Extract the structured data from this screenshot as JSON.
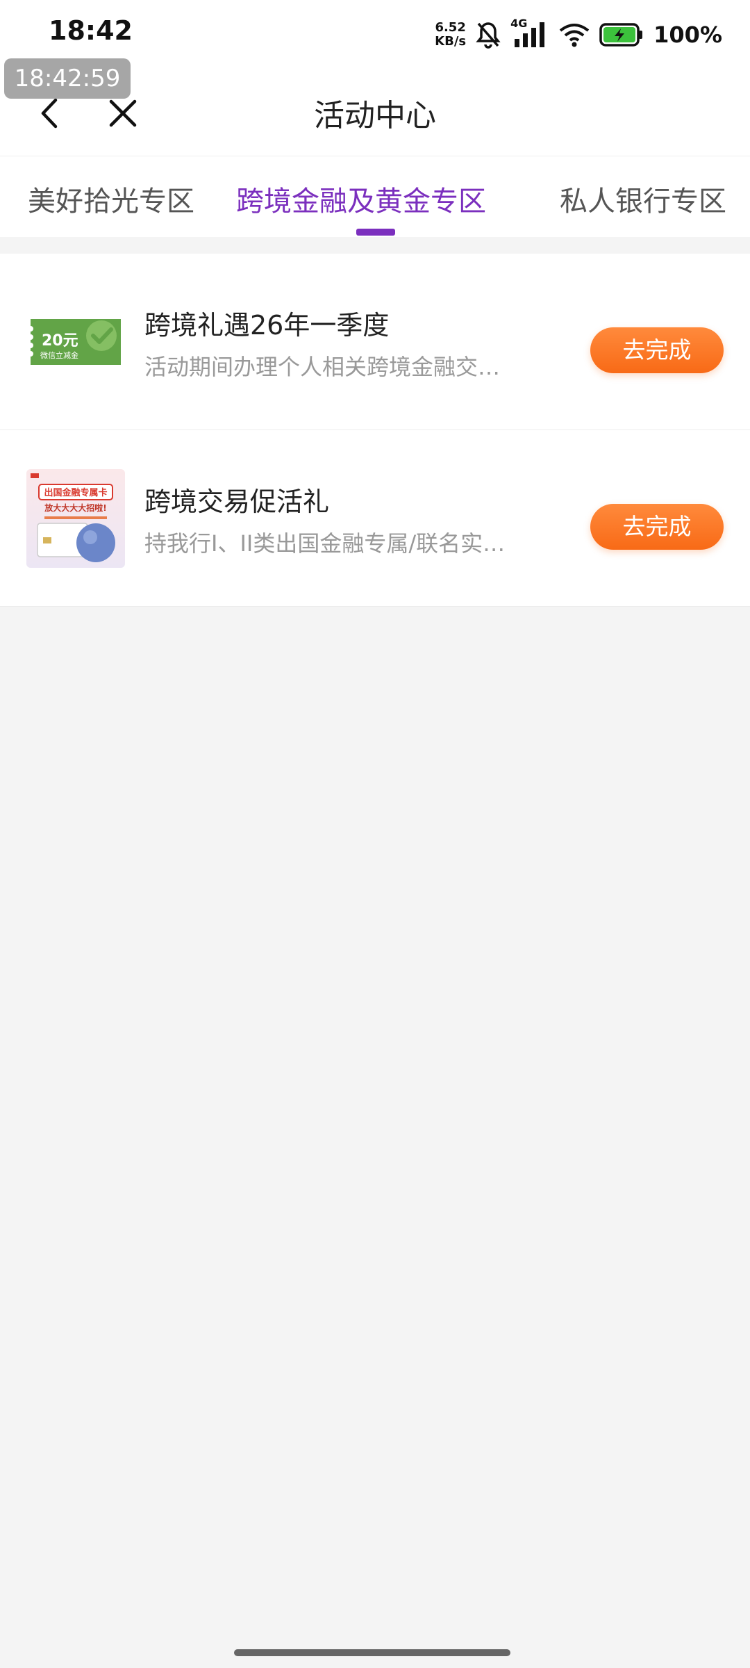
{
  "status_bar": {
    "time": "18:42",
    "net_speed_value": "6.52",
    "net_speed_unit": "KB/s",
    "network_type": "4G",
    "battery_percent": "100%",
    "icons": [
      "bell-muted-icon",
      "signal-icon",
      "wifi-icon",
      "battery-charging-icon"
    ]
  },
  "overlay": {
    "timestamp": "18:42:59"
  },
  "header": {
    "title": "活动中心",
    "icons": [
      "back-arrow-icon",
      "close-icon"
    ]
  },
  "tabs": [
    {
      "label": "美好拾光专区",
      "active": false
    },
    {
      "label": "跨境金融及黄金专区",
      "active": true
    },
    {
      "label": "私人银行专区",
      "active": false
    }
  ],
  "colors": {
    "accent": "#7b2fbe",
    "button": "#f86a16",
    "background": "#f4f4f4"
  },
  "activities": [
    {
      "title": "跨境礼遇26年一季度",
      "description": "活动期间办理个人相关跨境金融交…",
      "button_label": "去完成",
      "thumbnail": {
        "amount": "20元",
        "caption": "微信立减金"
      }
    },
    {
      "title": "跨境交易促活礼",
      "description": "持我行I、II类出国金融专属/联名实…",
      "button_label": "去完成",
      "thumbnail": {
        "headline": "出国金融专属卡",
        "slogan": "放大大大大招啦!"
      }
    }
  ]
}
